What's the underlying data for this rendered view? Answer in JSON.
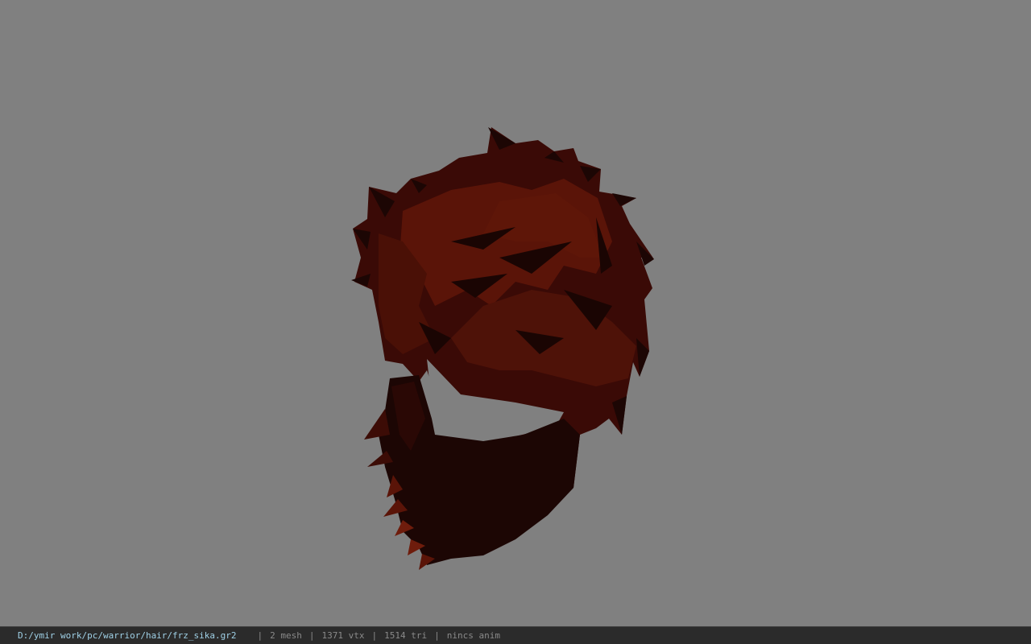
{
  "viewer": {
    "background_color": "#808080",
    "model_colors": {
      "dark": "#140404",
      "mid": "#3a0a06",
      "light": "#5a1408",
      "highlight": "#6e1c0c"
    }
  },
  "status_bar": {
    "file_path": "D:/ymir work/pc/warrior/hair/frz_sika.gr2",
    "separator": "|",
    "mesh_count": "2 mesh",
    "vertex_count": "1371 vtx",
    "triangle_count": "1514 tri",
    "anim": "nincs anim"
  }
}
